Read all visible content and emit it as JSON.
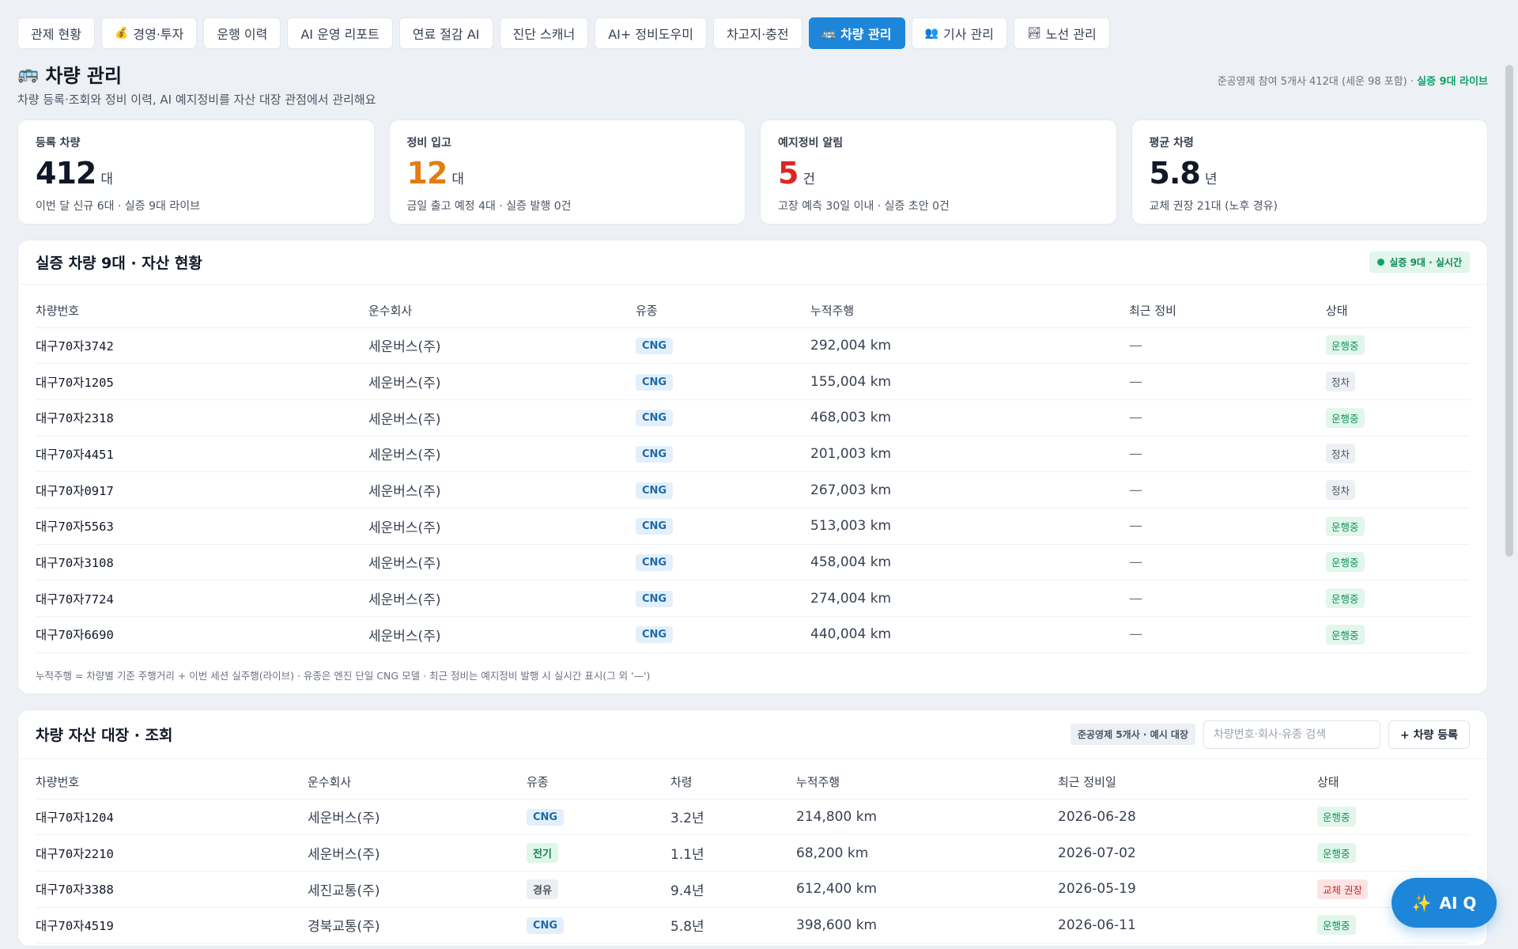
{
  "tabs": [
    {
      "label": "관제 현황",
      "icon": ""
    },
    {
      "label": "경영·투자",
      "icon": "💰"
    },
    {
      "label": "운행 이력",
      "icon": ""
    },
    {
      "label": "AI 운영 리포트",
      "icon": ""
    },
    {
      "label": "연료 절감 AI",
      "icon": ""
    },
    {
      "label": "진단 스캐너",
      "icon": ""
    },
    {
      "label": "AI+ 정비도우미",
      "icon": ""
    },
    {
      "label": "차고지·충전",
      "icon": ""
    },
    {
      "label": "차량 관리",
      "icon": "🚌"
    },
    {
      "label": "기사 관리",
      "icon": "👥"
    },
    {
      "label": "노선 관리",
      "icon": "🏞"
    }
  ],
  "active_tab": "차량 관리",
  "page": {
    "icon": "🚌",
    "title": "차량 관리",
    "subtitle": "차량 등록·조회와 정비 이력, AI 예지정비를 자산 대장 관점에서 관리해요",
    "right_info": "준공영제 참여 5개사 412대 (세운 98 포함) · ",
    "right_live": "실증 9대 라이브"
  },
  "kpis": [
    {
      "label": "등록 차량",
      "value": "412",
      "unit": "대",
      "sub": "이번 달 신규 6대 · 실증 9대 라이브",
      "color": "#111827"
    },
    {
      "label": "정비 입고",
      "value": "12",
      "unit": "대",
      "sub": "금일 출고 예정 4대 · 실증 발행 0건",
      "color": "#e27d12"
    },
    {
      "label": "예지정비 알림",
      "value": "5",
      "unit": "건",
      "sub": "고장 예측 30일 이내 · 실증 초안 0건",
      "color": "#dc2626"
    },
    {
      "label": "평균 차령",
      "value": "5.8",
      "unit": "년",
      "sub": "교체 권장 21대 (노후 경유)",
      "color": "#111827"
    }
  ],
  "live_card": {
    "title": "실증 차량 9대 · 자산 현황",
    "pill": "실증 9대 · 실시간",
    "columns": [
      "차량번호",
      "운수회사",
      "유종",
      "누적주행",
      "최근 정비",
      "상태"
    ],
    "rows": [
      {
        "plate": "대구70자3742",
        "company": "세운버스(주)",
        "fuel": "CNG",
        "mileage": "292,004 km",
        "last": "—",
        "status": "운행중"
      },
      {
        "plate": "대구70자1205",
        "company": "세운버스(주)",
        "fuel": "CNG",
        "mileage": "155,004 km",
        "last": "—",
        "status": "정차"
      },
      {
        "plate": "대구70자2318",
        "company": "세운버스(주)",
        "fuel": "CNG",
        "mileage": "468,003 km",
        "last": "—",
        "status": "운행중"
      },
      {
        "plate": "대구70자4451",
        "company": "세운버스(주)",
        "fuel": "CNG",
        "mileage": "201,003 km",
        "last": "—",
        "status": "정차"
      },
      {
        "plate": "대구70자0917",
        "company": "세운버스(주)",
        "fuel": "CNG",
        "mileage": "267,003 km",
        "last": "—",
        "status": "정차"
      },
      {
        "plate": "대구70자5563",
        "company": "세운버스(주)",
        "fuel": "CNG",
        "mileage": "513,003 km",
        "last": "—",
        "status": "운행중"
      },
      {
        "plate": "대구70자3108",
        "company": "세운버스(주)",
        "fuel": "CNG",
        "mileage": "458,004 km",
        "last": "—",
        "status": "운행중"
      },
      {
        "plate": "대구70자7724",
        "company": "세운버스(주)",
        "fuel": "CNG",
        "mileage": "274,004 km",
        "last": "—",
        "status": "운행중"
      },
      {
        "plate": "대구70자6690",
        "company": "세운버스(주)",
        "fuel": "CNG",
        "mileage": "440,004 km",
        "last": "—",
        "status": "운행중"
      }
    ],
    "footnote": "누적주행 = 차량별 기준 주행거리 + 이번 세션 실주행(라이브) · 유종은 엔진 단일 CNG 모델 · 최근 정비는 예지정비 발행 시 실시간 표시(그 외 '—')"
  },
  "ledger": {
    "title": "차량 자산 대장 · 조회",
    "pill": "준공영제 5개사 · 예시 대장",
    "search_placeholder": "차량번호·회사·유종 검색",
    "register_label": "+ 차량 등록",
    "columns": [
      "차량번호",
      "운수회사",
      "유종",
      "차령",
      "누적주행",
      "최근 정비일",
      "상태"
    ],
    "rows": [
      {
        "plate": "대구70자1204",
        "company": "세운버스(주)",
        "fuel": "CNG",
        "age": "3.2년",
        "mileage": "214,800 km",
        "date": "2026-06-28",
        "status": "운행중"
      },
      {
        "plate": "대구70자2210",
        "company": "세운버스(주)",
        "fuel": "전기",
        "age": "1.1년",
        "mileage": "68,200 km",
        "date": "2026-07-02",
        "status": "운행중"
      },
      {
        "plate": "대구70자3388",
        "company": "세진교통(주)",
        "fuel": "경유",
        "age": "9.4년",
        "mileage": "612,400 km",
        "date": "2026-05-19",
        "status": "교체 권장"
      },
      {
        "plate": "대구70자4519",
        "company": "경북교통(주)",
        "fuel": "CNG",
        "age": "5.8년",
        "mileage": "398,600 km",
        "date": "2026-06-11",
        "status": "운행중"
      }
    ]
  },
  "fab": {
    "label": "AI Q",
    "icon": "sparkles-icon"
  }
}
